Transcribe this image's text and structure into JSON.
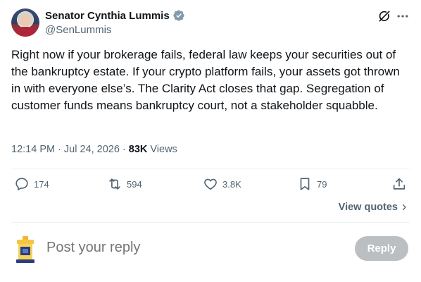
{
  "author": {
    "name": "Senator Cynthia Lummis",
    "handle": "@SenLummis",
    "verified": true
  },
  "tweet": {
    "text": "Right now if your brokerage fails, federal law keeps your securities out of the bankruptcy estate. If your crypto platform fails, your assets got thrown in with everyone else’s. The Clarity Act closes that gap. Segregation of customer funds means bankruptcy court, not a stakeholder squabble.",
    "time": "12:14 PM",
    "date": "Jul 24, 2026",
    "separator": "·",
    "views_count": "83K",
    "views_label": "Views"
  },
  "actions": {
    "replies": "174",
    "reposts": "594",
    "likes": "3.8K",
    "bookmarks": "79"
  },
  "view_quotes_label": "View quotes",
  "reply_box": {
    "placeholder": "Post your reply",
    "button_label": "Reply"
  },
  "colors": {
    "text_primary": "#0f1419",
    "text_secondary": "#536471",
    "verified_blue": "#829aab",
    "divider": "#eff3f4",
    "reply_button": "#8f969b"
  },
  "icons": {
    "verified": "verified-badge-icon",
    "grok": "grok-icon",
    "more": "more-dots-icon",
    "reply": "comment-bubble-icon",
    "repost": "repost-arrows-icon",
    "like": "heart-icon",
    "bookmark": "bookmark-icon",
    "share": "share-upload-icon",
    "chevron": "chevron-right-icon"
  }
}
